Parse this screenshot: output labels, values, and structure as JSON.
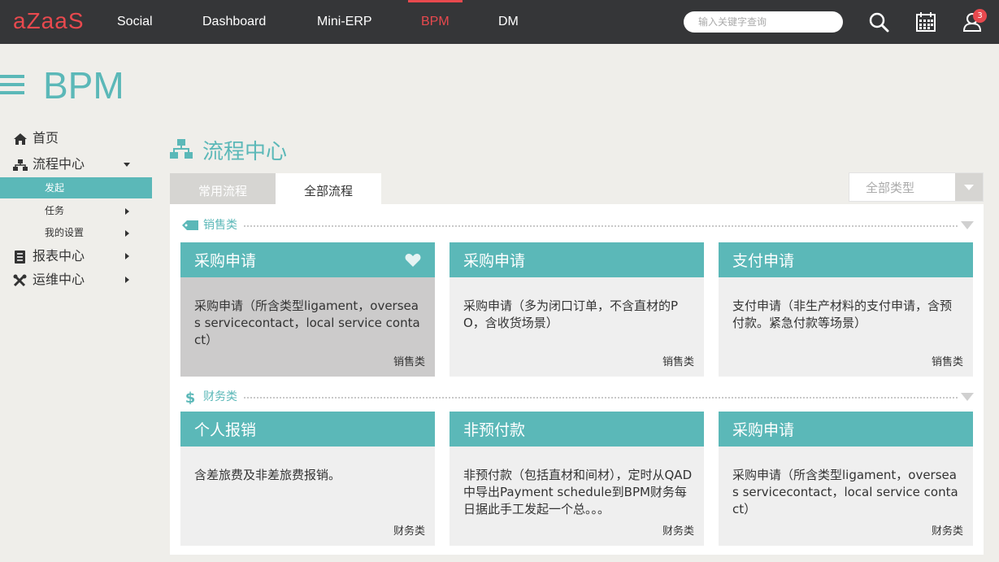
{
  "header": {
    "logo": "aZaaS",
    "nav": [
      {
        "label": "Social"
      },
      {
        "label": "Dashboard"
      },
      {
        "label": "Mini-ERP"
      },
      {
        "label": "BPM"
      },
      {
        "label": "DM"
      }
    ],
    "active_nav": "BPM",
    "search_placeholder": "输入关键字查询",
    "notification_count": "3",
    "accent_color": "#e8494e"
  },
  "page": {
    "title": "BPM",
    "theme_color": "#5bb8b8"
  },
  "sidebar": {
    "home": "首页",
    "process_center": "流程中心",
    "sub_items": [
      {
        "label": "发起"
      },
      {
        "label": "任务"
      },
      {
        "label": "我的设置"
      }
    ],
    "report_center": "报表中心",
    "ops_center": "运维中心"
  },
  "main": {
    "section_title": "流程中心",
    "tabs": [
      {
        "label": "常用流程"
      },
      {
        "label": "全部流程"
      }
    ],
    "active_tab": "全部流程",
    "type_select": "全部类型",
    "categories": [
      {
        "name": "销售类",
        "icon": "sale-tag-icon",
        "cards": [
          {
            "title": "采购申请",
            "desc": "采购申请（所含类型ligament，overseas servicecontact，local service contact）",
            "category": "销售类",
            "favorite": true
          },
          {
            "title": "采购申请",
            "desc": "采购申请（多为闭口订单，不含直材的PO，含收货场景）",
            "category": "销售类"
          },
          {
            "title": "支付申请",
            "desc": "支付申请（非生产材料的支付申请，含预付款。紧急付款等场景）",
            "category": "销售类"
          }
        ]
      },
      {
        "name": "财务类",
        "icon": "dollar-icon",
        "cards": [
          {
            "title": "个人报销",
            "desc": "含差旅费及非差旅费报销。",
            "category": "财务类"
          },
          {
            "title": "非预付款",
            "desc": "非预付款（包括直材和间材），定时从QAD中导出Payment schedule到BPM财务每日据此手工发起一个总。。。",
            "category": "财务类"
          },
          {
            "title": "采购申请",
            "desc": "采购申请（所含类型ligament，overseas servicecontact，local service contact）",
            "category": "财务类"
          }
        ]
      }
    ]
  }
}
